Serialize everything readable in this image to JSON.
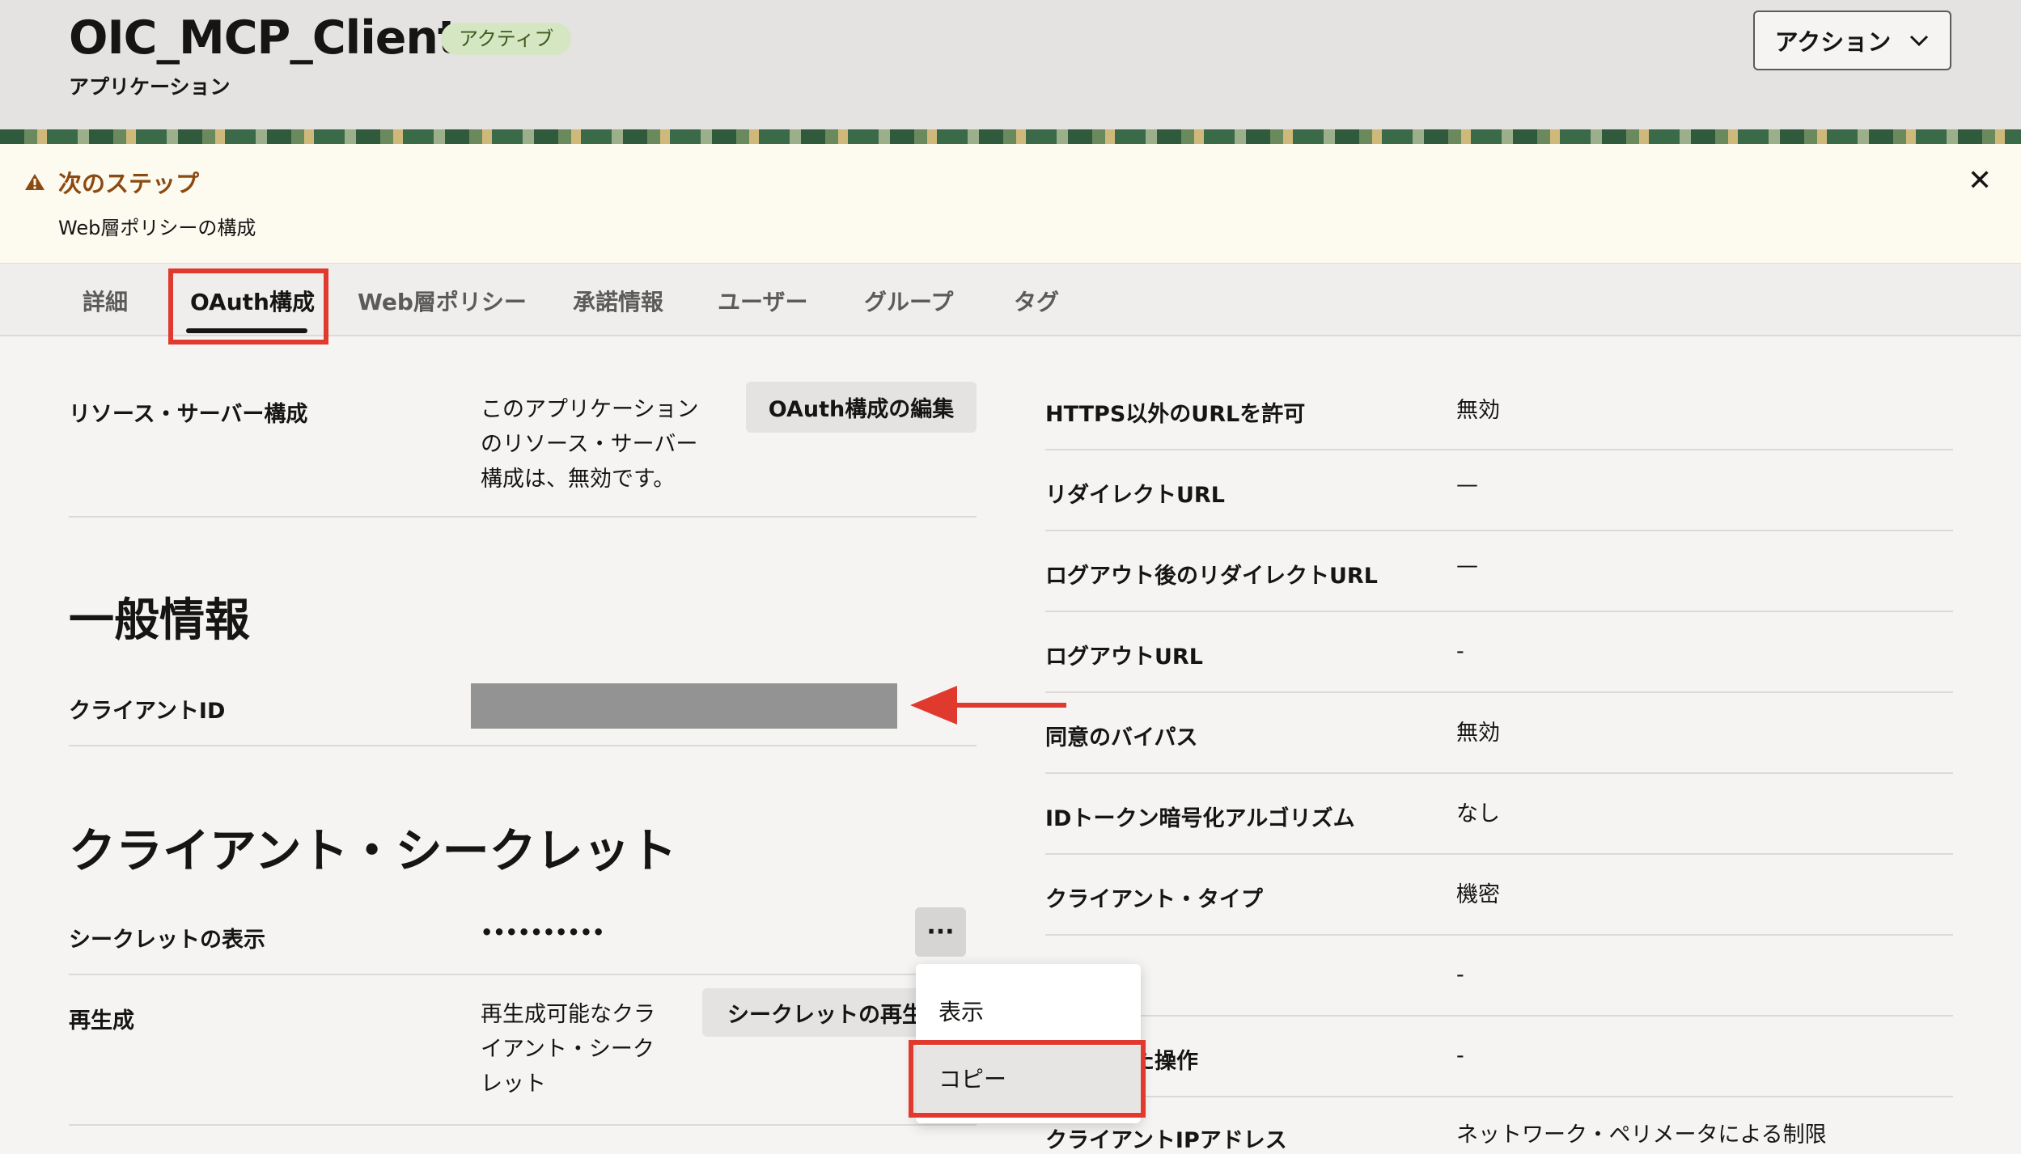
{
  "header": {
    "title": "OIC_MCP_Client",
    "status": "アクティブ",
    "subtitle": "アプリケーション",
    "action_label": "アクション"
  },
  "notice": {
    "title": "次のステップ",
    "body": "Web層ポリシーの構成"
  },
  "tabs": [
    {
      "label": "詳細"
    },
    {
      "label": "OAuth構成",
      "active": true
    },
    {
      "label": "Web層ポリシー"
    },
    {
      "label": "承諾情報"
    },
    {
      "label": "ユーザー"
    },
    {
      "label": "グループ"
    },
    {
      "label": "タグ"
    }
  ],
  "resource_server": {
    "label": "リソース・サーバー構成",
    "value_lines": [
      "このアプリケーション",
      "のリソース・サーバー",
      "構成は、無効です。"
    ],
    "edit_button": "OAuth構成の編集"
  },
  "general": {
    "heading": "一般情報",
    "client_id_label": "クライアントID"
  },
  "secret": {
    "heading": "クライアント・シークレット",
    "show_label": "シークレットの表示",
    "masked_value": "••••••••••",
    "more_label": "···",
    "regen_label": "再生成",
    "regen_value_lines": [
      "再生成可能なクラ",
      "イアント・シーク",
      "レット"
    ],
    "regen_button": "シークレットの再生成"
  },
  "menu": {
    "items": [
      "表示",
      "コピー"
    ]
  },
  "right_fields": [
    {
      "label": "HTTPS以外のURLを許可",
      "value": "無効"
    },
    {
      "label": "リダイレクトURL",
      "value": "—"
    },
    {
      "label": "ログアウト後のリダイレクトURL",
      "value": "—"
    },
    {
      "label": "ログアウトURL",
      "value": "-"
    },
    {
      "label": "同意のバイパス",
      "value": "無効"
    },
    {
      "label": "IDトークン暗号化アルゴリズム",
      "value": "なし"
    },
    {
      "label": "クライアント・タイプ",
      "value": "機密"
    },
    {
      "label": "",
      "value": "-"
    },
    {
      "label": "許可された操作",
      "value": "-"
    },
    {
      "label": "クライアントIPアドレス",
      "value": "ネットワーク・ペリメータによる制限"
    }
  ],
  "colors": {
    "highlight": "#e03a2e",
    "badge_bg": "#d4e7c2",
    "notice_title": "#8b4a12"
  }
}
